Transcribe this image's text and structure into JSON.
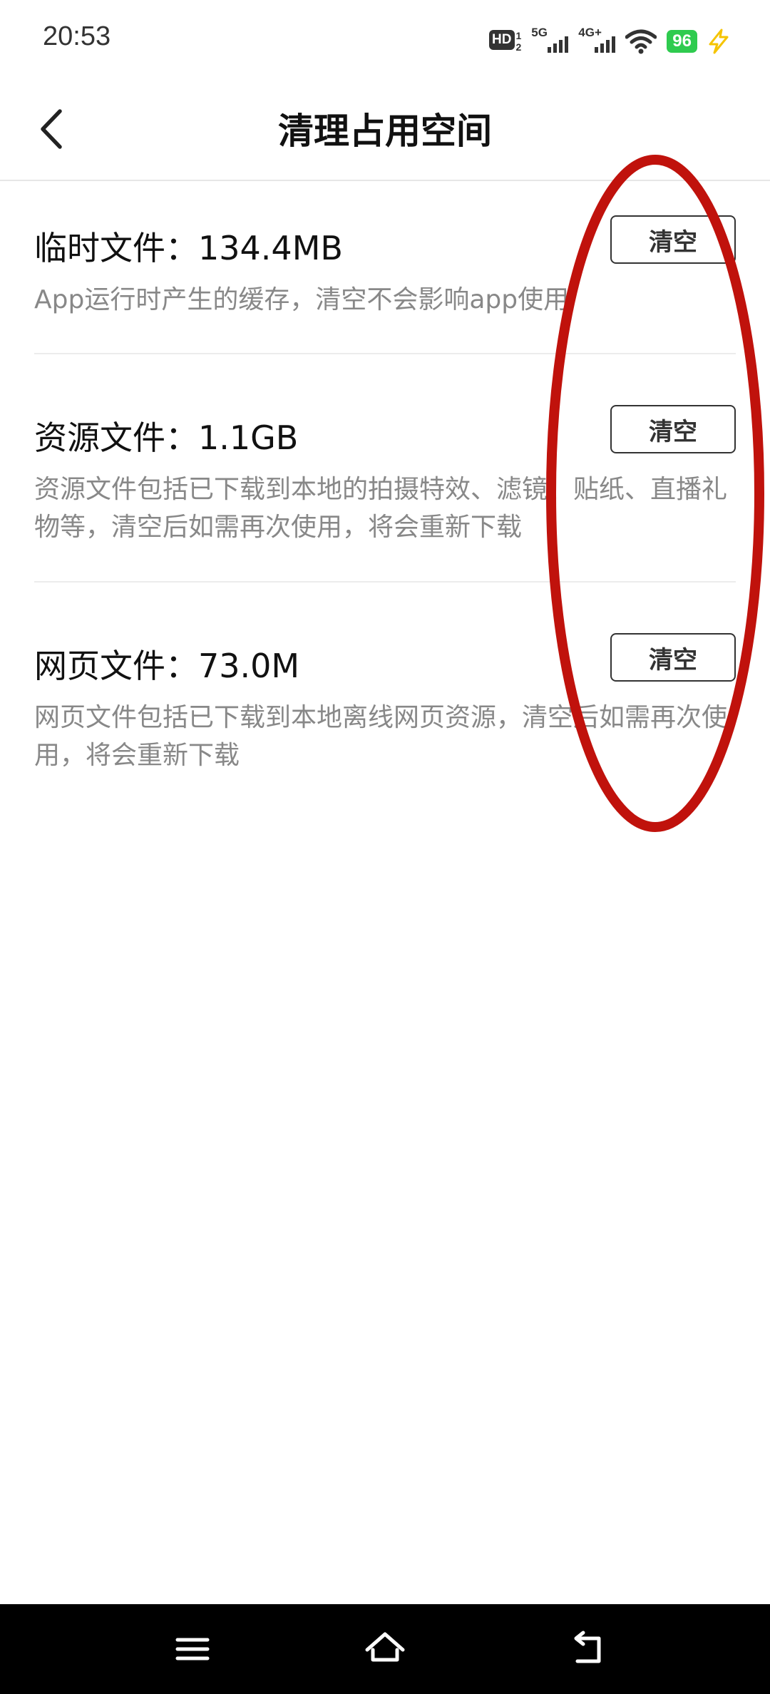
{
  "status_bar": {
    "time": "20:53",
    "hd_label": "HD",
    "hd_sup": "1",
    "hd_sub": "2",
    "net1_label": "5G",
    "net2_label": "4G+",
    "battery": "96",
    "battery_color": "#2fcb4f",
    "charging_color": "#f5c400"
  },
  "header": {
    "title": "清理占用空间",
    "back_icon": "chevron-left-icon"
  },
  "items": [
    {
      "title": "临时文件：134.4MB",
      "desc": "App运行时产生的缓存，清空不会影响app使用",
      "button": "清空"
    },
    {
      "title": "资源文件：1.1GB",
      "desc": "资源文件包括已下载到本地的拍摄特效、滤镜、贴纸、直播礼物等，清空后如需再次使用，将会重新下载",
      "button": "清空"
    },
    {
      "title": "网页文件：73.0M",
      "desc": "网页文件包括已下载到本地离线网页资源，清空后如需再次使用，将会重新下载",
      "button": "清空"
    }
  ],
  "annotation": {
    "shape": "ellipse",
    "color": "#c0120c"
  },
  "nav": {
    "menu_icon": "menu-icon",
    "home_icon": "home-icon",
    "back_icon": "return-icon"
  }
}
